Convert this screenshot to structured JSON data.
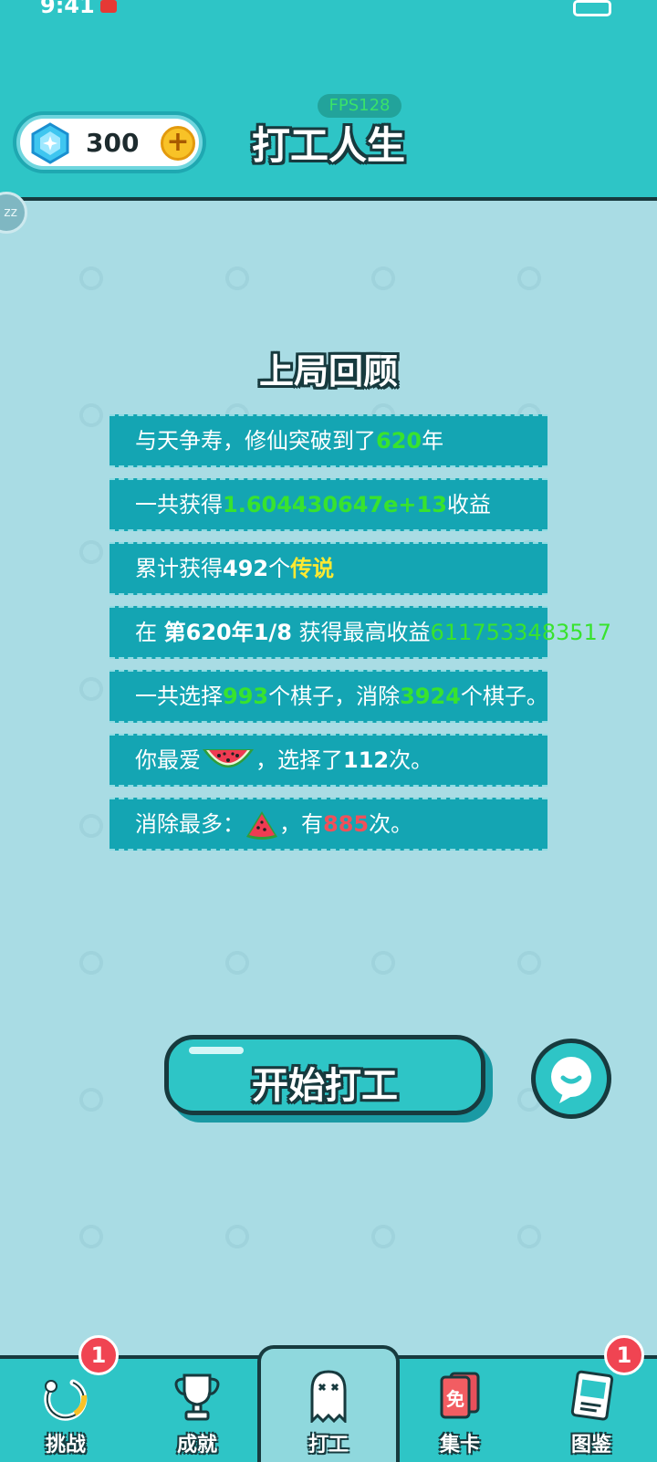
{
  "status": {
    "time": "9:41"
  },
  "header": {
    "gems": "300",
    "fps": "FPS128",
    "title": "打工人生"
  },
  "side_bubble": "zz",
  "review": {
    "title": "上局回顾",
    "rows": [
      {
        "parts": [
          "与天争寿，修仙突破到了",
          "620",
          "年"
        ]
      },
      {
        "parts": [
          "一共获得",
          "1.604430647e+13",
          "收益"
        ]
      },
      {
        "parts": [
          "累计获得",
          "492",
          "个",
          "传说"
        ]
      },
      {
        "parts": [
          "在 ",
          "第620年1/8",
          " 获得最高收益",
          "6117533483517"
        ]
      },
      {
        "parts": [
          "一共选择",
          "993",
          "个棋子，消除",
          "3924",
          "个棋子。"
        ]
      },
      {
        "parts": [
          "你最爱",
          "，选择了",
          "112",
          "次。"
        ]
      },
      {
        "parts": [
          "消除最多：",
          "，有",
          "885",
          "次。"
        ]
      }
    ]
  },
  "start_button": "开始打工",
  "tabs": [
    {
      "label": "挑战",
      "badge": "1"
    },
    {
      "label": "成就"
    },
    {
      "label": "打工"
    },
    {
      "label": "集卡",
      "icon_text": "免"
    },
    {
      "label": "图鉴",
      "badge": "1"
    }
  ],
  "colors": {
    "teal": "#2ec5c6",
    "row": "#14a5b3",
    "green": "#38e32e",
    "yellow": "#ffe930",
    "red": "#f0505a"
  }
}
